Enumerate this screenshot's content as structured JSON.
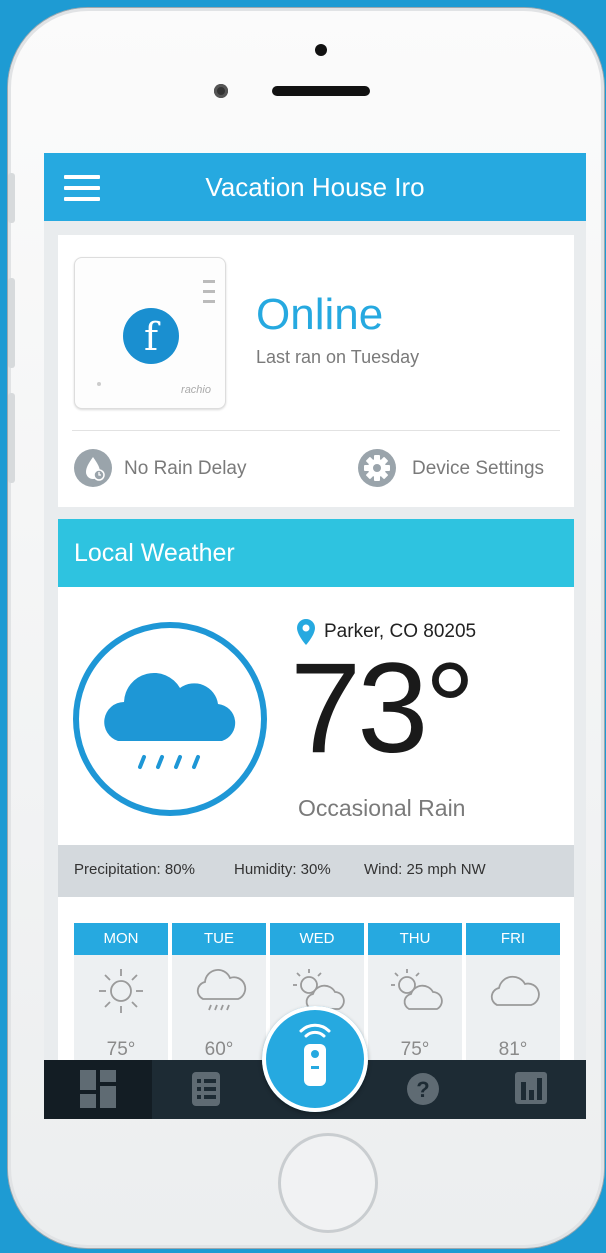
{
  "app_bar": {
    "title": "Vacation House Iro",
    "menu_icon": "hamburger-icon"
  },
  "device": {
    "status": "Online",
    "last_ran": "Last ran on Tuesday",
    "brand": "rachio",
    "rain_delay_label": "No Rain Delay",
    "settings_label": "Device Settings"
  },
  "weather": {
    "header": "Local Weather",
    "location": "Parker, CO 80205",
    "temperature": "73°",
    "condition": "Occasional Rain",
    "precipitation": "Precipitation: 80%",
    "humidity": "Humidity: 30%",
    "wind": "Wind: 25 mph NW",
    "forecast": [
      {
        "day": "MON",
        "icon": "sun-icon",
        "temp": "75°"
      },
      {
        "day": "TUE",
        "icon": "rain-cloud-icon",
        "temp": "60°"
      },
      {
        "day": "WED",
        "icon": "partly-cloudy-icon",
        "temp": ""
      },
      {
        "day": "THU",
        "icon": "partly-cloudy-icon",
        "temp": "75°"
      },
      {
        "day": "FRI",
        "icon": "cloud-icon",
        "temp": "81°"
      }
    ]
  },
  "bottom_nav": {
    "items": [
      {
        "name": "dashboard-icon",
        "active": true
      },
      {
        "name": "list-icon",
        "active": false
      },
      {
        "name": "remote-icon",
        "active": false
      },
      {
        "name": "help-icon",
        "active": false
      },
      {
        "name": "reports-icon",
        "active": false
      }
    ]
  },
  "colors": {
    "accent": "#26a9e0",
    "weather_header": "#2ec3e0",
    "nav_background": "#1d2b34",
    "background": "#1e9bd3"
  }
}
